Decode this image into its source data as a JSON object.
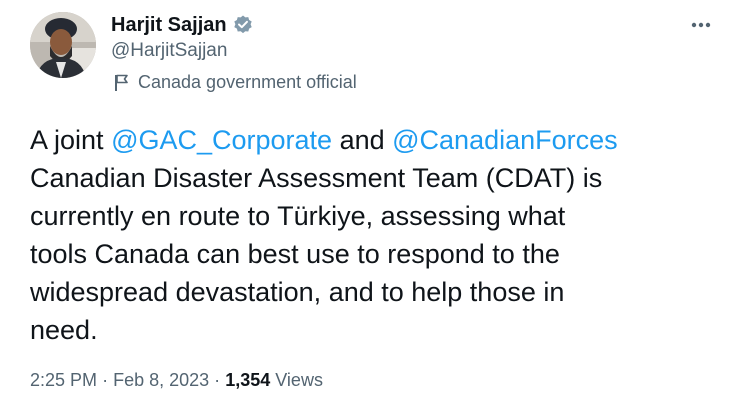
{
  "author": {
    "display_name": "Harjit Sajjan",
    "handle": "@HarjitSajjan",
    "label": "Canada government official",
    "verified": true,
    "verified_color": "#829aab"
  },
  "tweet": {
    "segments": [
      {
        "line": 1,
        "parts": [
          {
            "text": "A joint ",
            "type": "text"
          },
          {
            "text": "@GAC_Corporate",
            "type": "mention"
          },
          {
            "text": " and ",
            "type": "text"
          },
          {
            "text": "@CanadianForces",
            "type": "mention"
          }
        ]
      },
      {
        "line": 2,
        "parts": [
          {
            "text": "Canadian Disaster Assessment Team (CDAT) is",
            "type": "text"
          }
        ]
      },
      {
        "line": 3,
        "parts": [
          {
            "text": "currently en route to Türkiye, assessing what",
            "type": "text"
          }
        ]
      },
      {
        "line": 4,
        "parts": [
          {
            "text": "tools Canada can best use to respond to the",
            "type": "text"
          }
        ]
      },
      {
        "line": 5,
        "parts": [
          {
            "text": "widespread devastation, and to help those in",
            "type": "text"
          }
        ]
      },
      {
        "line": 6,
        "parts": [
          {
            "text": "need.",
            "type": "text"
          }
        ]
      }
    ],
    "mention_color": "#1d9bf0"
  },
  "meta": {
    "time": "2:25 PM",
    "separator": "·",
    "date": "Feb 8, 2023",
    "views_count": "1,354",
    "views_label": "Views"
  },
  "icons": {
    "verified": "verified-badge-icon",
    "label": "flag-icon",
    "more": "more-options-icon"
  }
}
